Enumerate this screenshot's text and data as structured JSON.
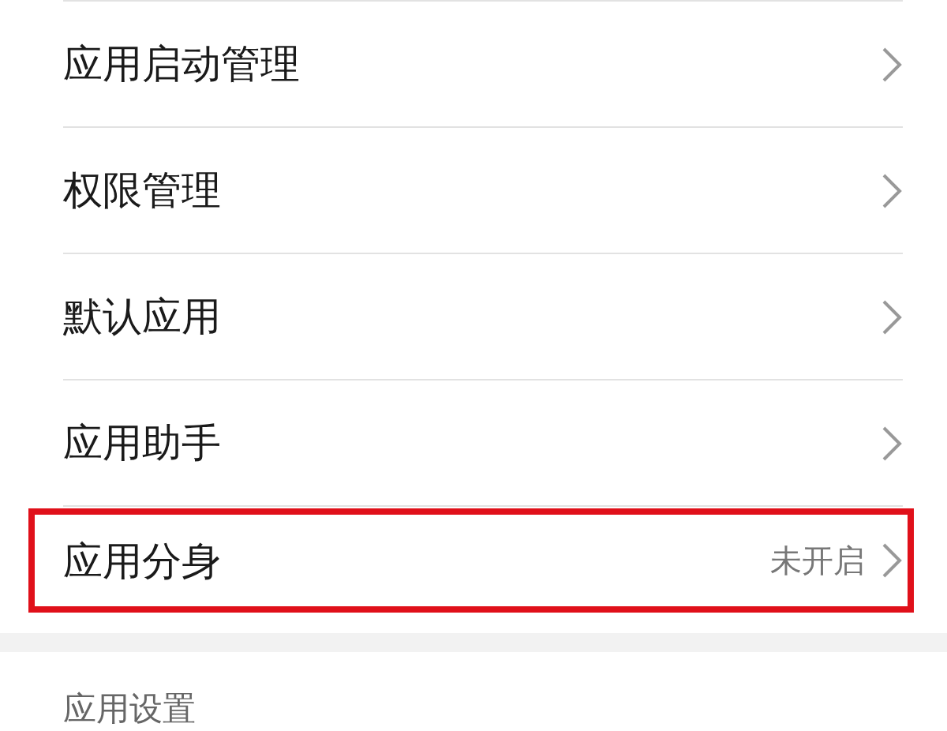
{
  "settings": [
    {
      "label": "应用启动管理",
      "highlighted": false
    },
    {
      "label": "权限管理",
      "highlighted": false
    },
    {
      "label": "默认应用",
      "highlighted": false
    },
    {
      "label": "应用助手",
      "highlighted": false
    },
    {
      "label": "应用分身",
      "value": "未开启",
      "highlighted": true
    }
  ],
  "section_header": "应用设置"
}
